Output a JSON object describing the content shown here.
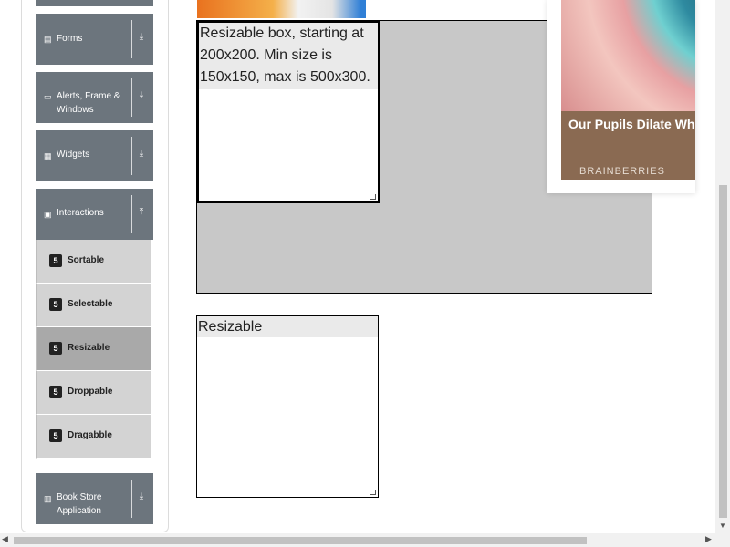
{
  "sidebar": {
    "groups": [
      {
        "label": "Forms",
        "icon": "form-icon",
        "icon_glyph": "▤",
        "arrow_glyph": "⤓"
      },
      {
        "label": "Alerts, Frame & Windows",
        "icon": "window-icon",
        "icon_glyph": "▭",
        "arrow_glyph": "⤓"
      },
      {
        "label": "Widgets",
        "icon": "grid-icon",
        "icon_glyph": "▦",
        "arrow_glyph": "⤓"
      },
      {
        "label": "Interactions",
        "icon": "interactions-icon",
        "icon_glyph": "▣",
        "arrow_glyph": "⤒"
      },
      {
        "label": "Book Store Application",
        "icon": "bookstore-icon",
        "icon_glyph": "▥",
        "arrow_glyph": "⤓"
      }
    ],
    "interaction_items": [
      {
        "label": "Sortable",
        "icon": "html5-icon",
        "icon_glyph": "5",
        "active": false
      },
      {
        "label": "Selectable",
        "icon": "html5-icon",
        "icon_glyph": "5",
        "active": false
      },
      {
        "label": "Resizable",
        "icon": "html5-icon",
        "icon_glyph": "5",
        "active": true
      },
      {
        "label": "Droppable",
        "icon": "html5-icon",
        "icon_glyph": "5",
        "active": false
      },
      {
        "label": "Dragabble",
        "icon": "html5-icon",
        "icon_glyph": "5",
        "active": false
      }
    ]
  },
  "main": {
    "box_with_restriction_text": "Resizable box, starting at 200x200. Min size is 150x150, max is 500x300.",
    "box_free_text": "Resizable"
  },
  "ad": {
    "headline": "Our Pupils Dilate When We See Our Loved Ones",
    "brand": "BRAINBERRIES"
  },
  "scrollbars": {
    "up_glyph": "▲",
    "down_glyph": "▼",
    "left_glyph": "◀",
    "right_glyph": "▶"
  },
  "colors": {
    "sidebar_header_bg": "#6c757d",
    "sidebar_item_bg": "#d3d3d3",
    "sidebar_item_active_bg": "#a9a9a9",
    "container_bg": "#c8c8c8"
  }
}
